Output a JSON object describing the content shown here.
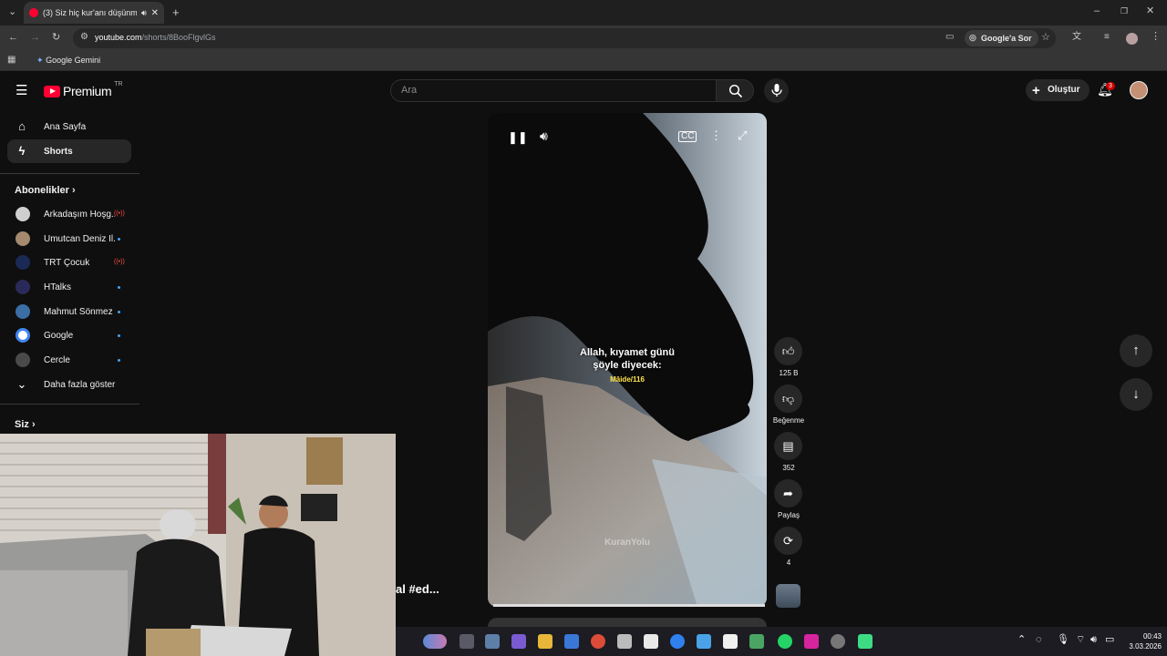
{
  "browser": {
    "tab_title": "(3) Siz hiç kur'anı düşünme...",
    "url_domain": "youtube.com",
    "url_path": "/shorts/8BooFlgvlGs",
    "google_ask_label": "Google'a Sor",
    "bookmark_label": "Google Gemini"
  },
  "header": {
    "brand": "Premium",
    "country_code": "TR",
    "search_placeholder": "Ara",
    "create_label": "Oluştur",
    "notification_count": "3"
  },
  "sidebar": {
    "items": [
      {
        "label": "Ana Sayfa"
      },
      {
        "label": "Shorts"
      }
    ],
    "subscriptions_title": "Abonelikler",
    "subscriptions": [
      {
        "label": "Arkadaşım Hoşg...",
        "color": "#cfcfcf",
        "status": "live"
      },
      {
        "label": "Umutcan Deniz İl...",
        "color": "#a58a70",
        "status": "new"
      },
      {
        "label": "TRT Çocuk",
        "color": "#1a2a55",
        "status": "live"
      },
      {
        "label": "HTalks",
        "color": "#2a2a5a",
        "status": "new"
      },
      {
        "label": "Mahmut Sönmez",
        "color": "#3b6ea5",
        "status": "new"
      },
      {
        "label": "Google",
        "color": "#ffffff",
        "status": "new"
      },
      {
        "label": "Cercle",
        "color": "#4a4a4a",
        "status": "new"
      }
    ],
    "show_more_label": "Daha fazla göster",
    "you_title": "Siz"
  },
  "video": {
    "caption_line1": "Allah, kıyamet günü",
    "caption_line2": "şöyle diyecek:",
    "reference": "Mâide/116",
    "watermark": "KuranYolu",
    "channel_handle_partial": "al #ed..."
  },
  "actions": {
    "likes": "125 B",
    "dislike_label": "Beğenme",
    "comments": "352",
    "share_label": "Paylaş",
    "remix_count": "4"
  },
  "taskbar": {
    "time": "00:43",
    "date": "3.03.2026"
  }
}
